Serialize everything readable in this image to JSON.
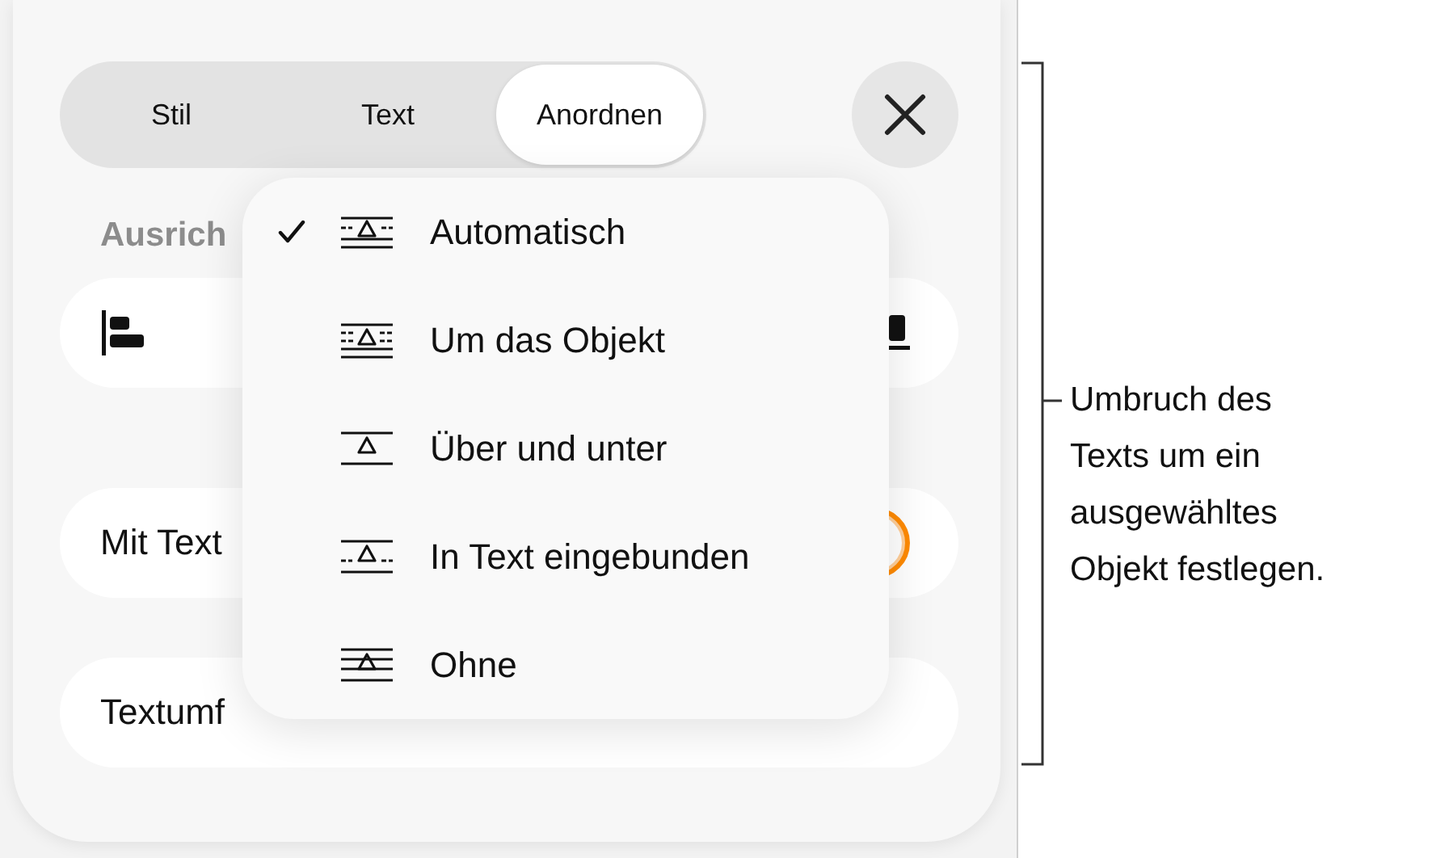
{
  "tabs": [
    {
      "label": "Stil",
      "selected": false
    },
    {
      "label": "Text",
      "selected": false
    },
    {
      "label": "Anordnen",
      "selected": true
    }
  ],
  "section_label": "Ausrich",
  "toggle_row": {
    "label": "Mit Text",
    "on": true
  },
  "wrap_row": {
    "label": "Textumf"
  },
  "wrap_menu": {
    "items": [
      {
        "label": "Automatisch",
        "selected": true,
        "kind": "auto"
      },
      {
        "label": "Um das Objekt",
        "selected": false,
        "kind": "around"
      },
      {
        "label": "Über und unter",
        "selected": false,
        "kind": "above_below"
      },
      {
        "label": "In Text eingebunden",
        "selected": false,
        "kind": "inline"
      },
      {
        "label": "Ohne",
        "selected": false,
        "kind": "none"
      }
    ]
  },
  "callout": {
    "text": "Umbruch des\nTexts um ein\nausgewähltes\nObjekt festlegen."
  }
}
